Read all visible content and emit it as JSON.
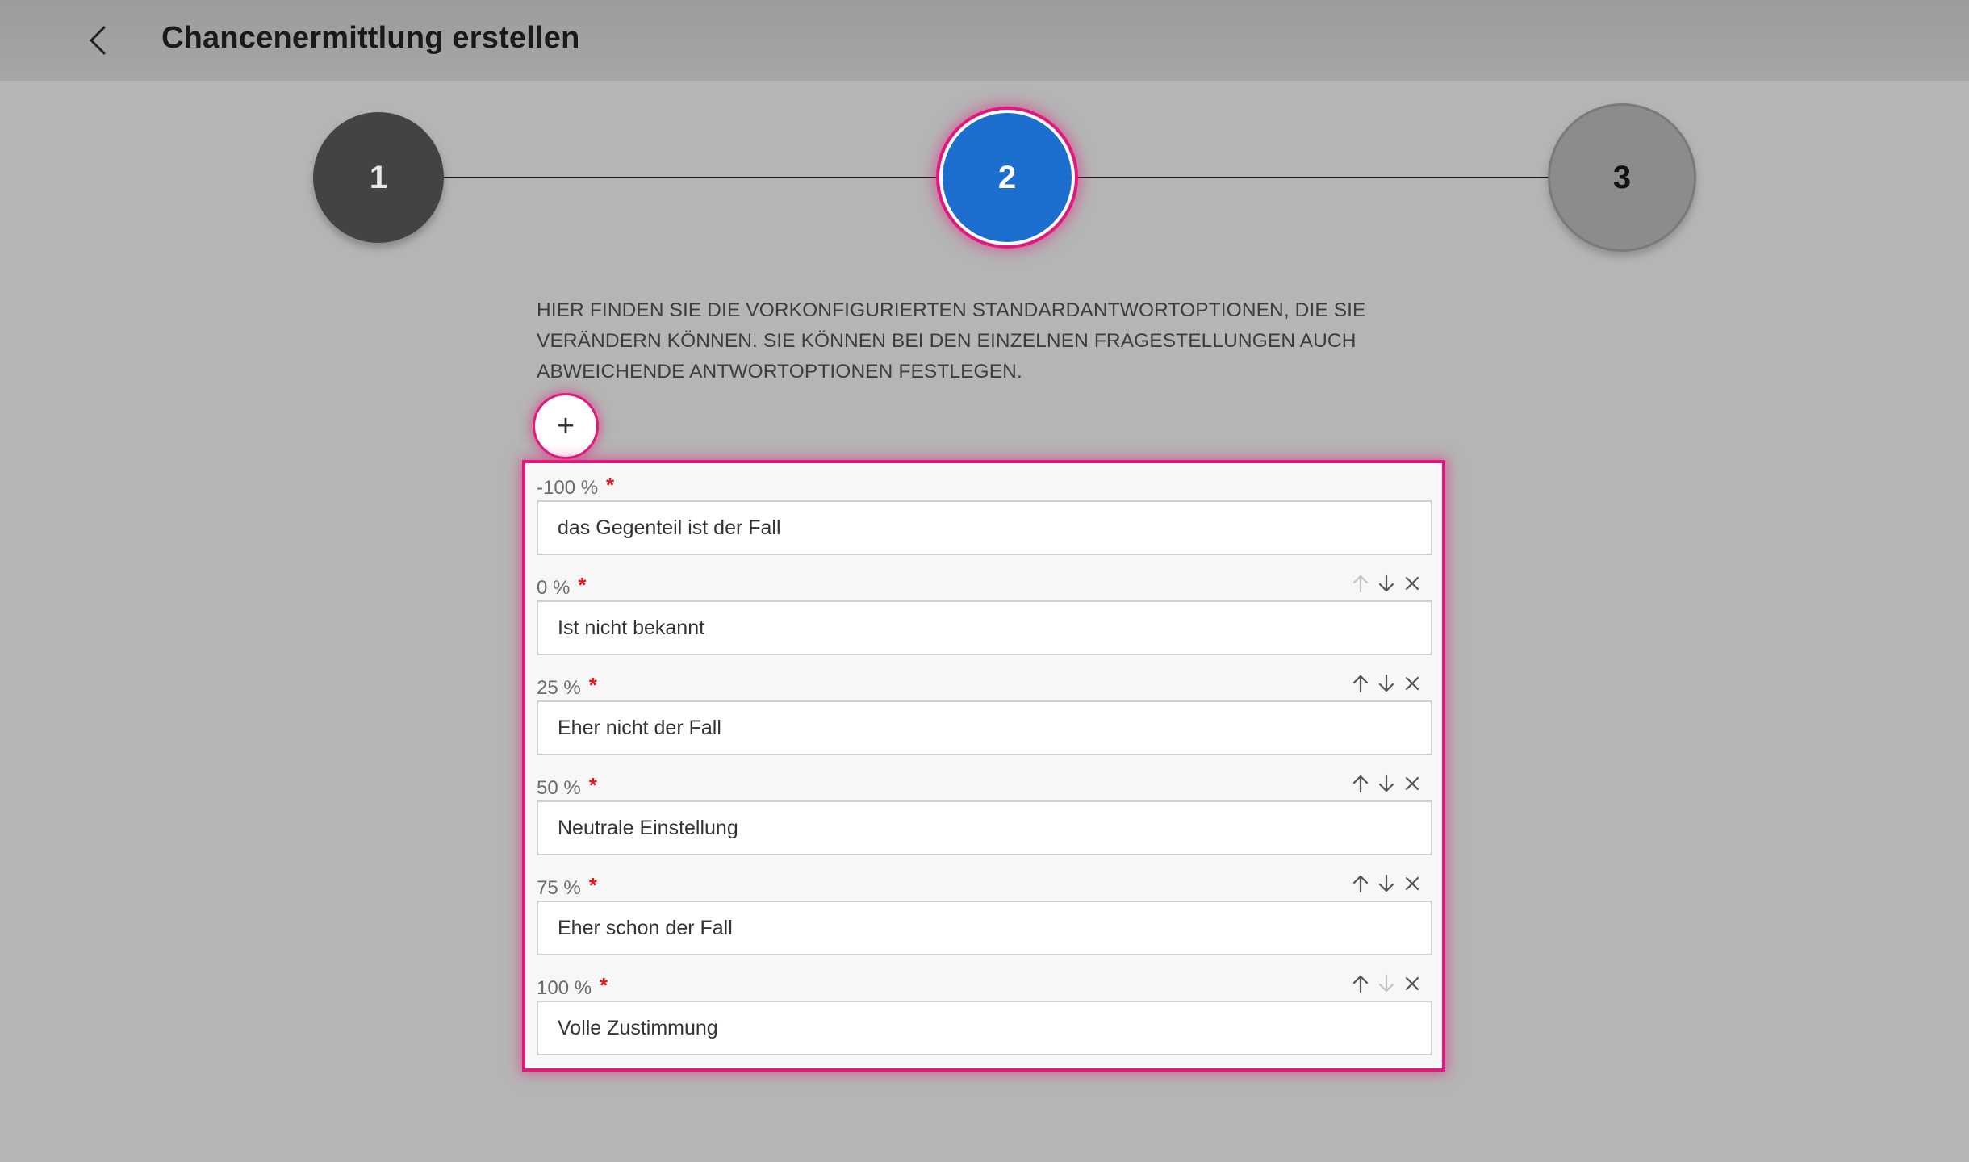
{
  "header": {
    "title": "Chancenermittlung erstellen"
  },
  "stepper": {
    "steps": [
      {
        "label": "1",
        "state": "completed"
      },
      {
        "label": "2",
        "state": "active"
      },
      {
        "label": "3",
        "state": "upcoming"
      }
    ],
    "active_color": "#1c6fcf",
    "highlight_color": "#e3177d"
  },
  "description": "HIER FINDEN SIE DIE VORKONFIGURIERTEN STANDARDANTWORTOPTIONEN, DIE SIE VERÄNDERN KÖNNEN. SIE KÖNNEN BEI DEN EINZELNEN FRAGESTELLUNGEN AUCH ABWEICHENDE ANTWORTOPTIONEN FESTLEGEN.",
  "add_button": {
    "icon": "plus-icon",
    "label": "+"
  },
  "options": [
    {
      "percent_label": "-100 %",
      "required_mark": "*",
      "value": "das Gegenteil ist der Fall",
      "show_actions": false,
      "up_enabled": false,
      "down_enabled": false
    },
    {
      "percent_label": "0 %",
      "required_mark": "*",
      "value": "Ist nicht bekannt",
      "show_actions": true,
      "up_enabled": false,
      "down_enabled": true
    },
    {
      "percent_label": "25 %",
      "required_mark": "*",
      "value": "Eher nicht der Fall",
      "show_actions": true,
      "up_enabled": true,
      "down_enabled": true
    },
    {
      "percent_label": "50 %",
      "required_mark": "*",
      "value": "Neutrale Einstellung",
      "show_actions": true,
      "up_enabled": true,
      "down_enabled": true
    },
    {
      "percent_label": "75 %",
      "required_mark": "*",
      "value": "Eher schon der Fall",
      "show_actions": true,
      "up_enabled": true,
      "down_enabled": true
    },
    {
      "percent_label": "100 %",
      "required_mark": "*",
      "value": "Volle Zustimmung",
      "show_actions": true,
      "up_enabled": true,
      "down_enabled": false
    }
  ]
}
